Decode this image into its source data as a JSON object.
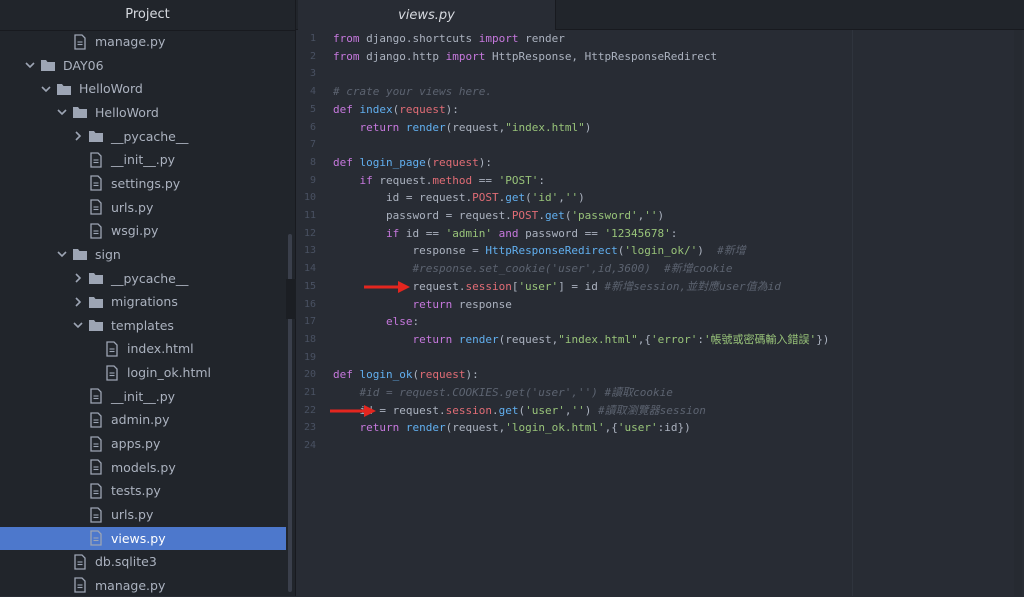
{
  "sidebar": {
    "title": "Project",
    "items": [
      {
        "label": "manage.py",
        "type": "file",
        "depth": 3,
        "chevron": "none"
      },
      {
        "label": "DAY06",
        "type": "folder",
        "depth": 1,
        "chevron": "down"
      },
      {
        "label": "HelloWord",
        "type": "folder",
        "depth": 2,
        "chevron": "down"
      },
      {
        "label": "HelloWord",
        "type": "folder",
        "depth": 3,
        "chevron": "down"
      },
      {
        "label": "__pycache__",
        "type": "folder",
        "depth": 4,
        "chevron": "right"
      },
      {
        "label": "__init__.py",
        "type": "file",
        "depth": 4,
        "chevron": "none"
      },
      {
        "label": "settings.py",
        "type": "file",
        "depth": 4,
        "chevron": "none"
      },
      {
        "label": "urls.py",
        "type": "file",
        "depth": 4,
        "chevron": "none"
      },
      {
        "label": "wsgi.py",
        "type": "file",
        "depth": 4,
        "chevron": "none"
      },
      {
        "label": "sign",
        "type": "folder",
        "depth": 3,
        "chevron": "down"
      },
      {
        "label": "__pycache__",
        "type": "folder",
        "depth": 4,
        "chevron": "right"
      },
      {
        "label": "migrations",
        "type": "folder",
        "depth": 4,
        "chevron": "right"
      },
      {
        "label": "templates",
        "type": "folder",
        "depth": 4,
        "chevron": "down"
      },
      {
        "label": "index.html",
        "type": "file",
        "depth": 5,
        "chevron": "none"
      },
      {
        "label": "login_ok.html",
        "type": "file",
        "depth": 5,
        "chevron": "none"
      },
      {
        "label": "__init__.py",
        "type": "file",
        "depth": 4,
        "chevron": "none"
      },
      {
        "label": "admin.py",
        "type": "file",
        "depth": 4,
        "chevron": "none"
      },
      {
        "label": "apps.py",
        "type": "file",
        "depth": 4,
        "chevron": "none"
      },
      {
        "label": "models.py",
        "type": "file",
        "depth": 4,
        "chevron": "none"
      },
      {
        "label": "tests.py",
        "type": "file",
        "depth": 4,
        "chevron": "none"
      },
      {
        "label": "urls.py",
        "type": "file",
        "depth": 4,
        "chevron": "none"
      },
      {
        "label": "views.py",
        "type": "file",
        "depth": 4,
        "chevron": "none",
        "selected": true
      },
      {
        "label": "db.sqlite3",
        "type": "file",
        "depth": 3,
        "chevron": "none"
      },
      {
        "label": "manage.py",
        "type": "file",
        "depth": 3,
        "chevron": "none"
      }
    ]
  },
  "editor": {
    "tab_title": "views.py",
    "arrow_color": "#e3261f",
    "arrow_lines": [
      15,
      22
    ],
    "lines": [
      [
        [
          "kw",
          "from"
        ],
        [
          "pl",
          " django.shortcuts "
        ],
        [
          "kw",
          "import"
        ],
        [
          "pl",
          " render"
        ]
      ],
      [
        [
          "kw",
          "from"
        ],
        [
          "pl",
          " django.http "
        ],
        [
          "kw",
          "import"
        ],
        [
          "pl",
          " HttpResponse, HttpResponseRedirect"
        ]
      ],
      [],
      [
        [
          "cm",
          "# crate your views here."
        ]
      ],
      [
        [
          "kw",
          "def"
        ],
        [
          "pl",
          " "
        ],
        [
          "fn",
          "index"
        ],
        [
          "pl",
          "("
        ],
        [
          "attr",
          "request"
        ],
        [
          "pl",
          "):"
        ]
      ],
      [
        [
          "pl",
          "    "
        ],
        [
          "kw",
          "return"
        ],
        [
          "pl",
          " "
        ],
        [
          "fn",
          "render"
        ],
        [
          "pl",
          "(request,"
        ],
        [
          "str",
          "\"index.html\""
        ],
        [
          "pl",
          ")"
        ]
      ],
      [],
      [
        [
          "kw",
          "def"
        ],
        [
          "pl",
          " "
        ],
        [
          "fn",
          "login_page"
        ],
        [
          "pl",
          "("
        ],
        [
          "attr",
          "request"
        ],
        [
          "pl",
          "):"
        ]
      ],
      [
        [
          "pl",
          "    "
        ],
        [
          "kw",
          "if"
        ],
        [
          "pl",
          " request."
        ],
        [
          "attr",
          "method"
        ],
        [
          "pl",
          " == "
        ],
        [
          "str",
          "'POST'"
        ],
        [
          "pl",
          ":"
        ]
      ],
      [
        [
          "pl",
          "        id = request."
        ],
        [
          "attr",
          "POST"
        ],
        [
          "pl",
          "."
        ],
        [
          "fn",
          "get"
        ],
        [
          "pl",
          "("
        ],
        [
          "str",
          "'id'"
        ],
        [
          "pl",
          ","
        ],
        [
          "str",
          "''"
        ],
        [
          "pl",
          ")"
        ]
      ],
      [
        [
          "pl",
          "        password = request."
        ],
        [
          "attr",
          "POST"
        ],
        [
          "pl",
          "."
        ],
        [
          "fn",
          "get"
        ],
        [
          "pl",
          "("
        ],
        [
          "str",
          "'password'"
        ],
        [
          "pl",
          ","
        ],
        [
          "str",
          "''"
        ],
        [
          "pl",
          ")"
        ]
      ],
      [
        [
          "pl",
          "        "
        ],
        [
          "kw",
          "if"
        ],
        [
          "pl",
          " id == "
        ],
        [
          "str",
          "'admin'"
        ],
        [
          "pl",
          " "
        ],
        [
          "kw",
          "and"
        ],
        [
          "pl",
          " password == "
        ],
        [
          "str",
          "'12345678'"
        ],
        [
          "pl",
          ":"
        ]
      ],
      [
        [
          "pl",
          "            response = "
        ],
        [
          "fn",
          "HttpResponseRedirect"
        ],
        [
          "pl",
          "("
        ],
        [
          "str",
          "'login_ok/'"
        ],
        [
          "pl",
          ")  "
        ],
        [
          "cm",
          "#新增"
        ]
      ],
      [
        [
          "pl",
          "            "
        ],
        [
          "cm",
          "#response.set_cookie('user',id,3600)  #新增cookie"
        ]
      ],
      [
        [
          "pl",
          "            request."
        ],
        [
          "attr",
          "session"
        ],
        [
          "pl",
          "["
        ],
        [
          "str",
          "'user'"
        ],
        [
          "pl",
          "] = id "
        ],
        [
          "cm",
          "#新增session,並對應user值為id"
        ]
      ],
      [
        [
          "pl",
          "            "
        ],
        [
          "kw",
          "return"
        ],
        [
          "pl",
          " response"
        ]
      ],
      [
        [
          "pl",
          "        "
        ],
        [
          "kw",
          "else"
        ],
        [
          "pl",
          ":"
        ]
      ],
      [
        [
          "pl",
          "            "
        ],
        [
          "kw",
          "return"
        ],
        [
          "pl",
          " "
        ],
        [
          "fn",
          "render"
        ],
        [
          "pl",
          "(request,"
        ],
        [
          "str",
          "\"index.html\""
        ],
        [
          "pl",
          ",{"
        ],
        [
          "str",
          "'error'"
        ],
        [
          "pl",
          ":"
        ],
        [
          "str",
          "'帳號或密碼輸入錯誤'"
        ],
        [
          "pl",
          "})"
        ]
      ],
      [],
      [
        [
          "kw",
          "def"
        ],
        [
          "pl",
          " "
        ],
        [
          "fn",
          "login_ok"
        ],
        [
          "pl",
          "("
        ],
        [
          "attr",
          "request"
        ],
        [
          "pl",
          "):"
        ]
      ],
      [
        [
          "pl",
          "    "
        ],
        [
          "cm",
          "#id = request.COOKIES.get('user','') #讀取cookie"
        ]
      ],
      [
        [
          "pl",
          "    id = request."
        ],
        [
          "attr",
          "session"
        ],
        [
          "pl",
          "."
        ],
        [
          "fn",
          "get"
        ],
        [
          "pl",
          "("
        ],
        [
          "str",
          "'user'"
        ],
        [
          "pl",
          ","
        ],
        [
          "str",
          "''"
        ],
        [
          "pl",
          ") "
        ],
        [
          "cm",
          "#讀取瀏覽器session"
        ]
      ],
      [
        [
          "pl",
          "    "
        ],
        [
          "kw",
          "return"
        ],
        [
          "pl",
          " "
        ],
        [
          "fn",
          "render"
        ],
        [
          "pl",
          "(request,"
        ],
        [
          "str",
          "'login_ok.html'"
        ],
        [
          "pl",
          ",{"
        ],
        [
          "str",
          "'user'"
        ],
        [
          "pl",
          ":id})"
        ]
      ],
      []
    ]
  },
  "colors": {
    "keyword": "#c678dd",
    "function": "#61afef",
    "string": "#98c379",
    "attribute": "#e06c75",
    "comment": "#5c6370",
    "selection": "#4d78cc"
  },
  "icons": {
    "folder": "folder-icon",
    "file": "file-icon",
    "collapse": "chevron-left-icon",
    "expanded": "chevron-down-icon",
    "collapsed": "chevron-right-icon"
  }
}
